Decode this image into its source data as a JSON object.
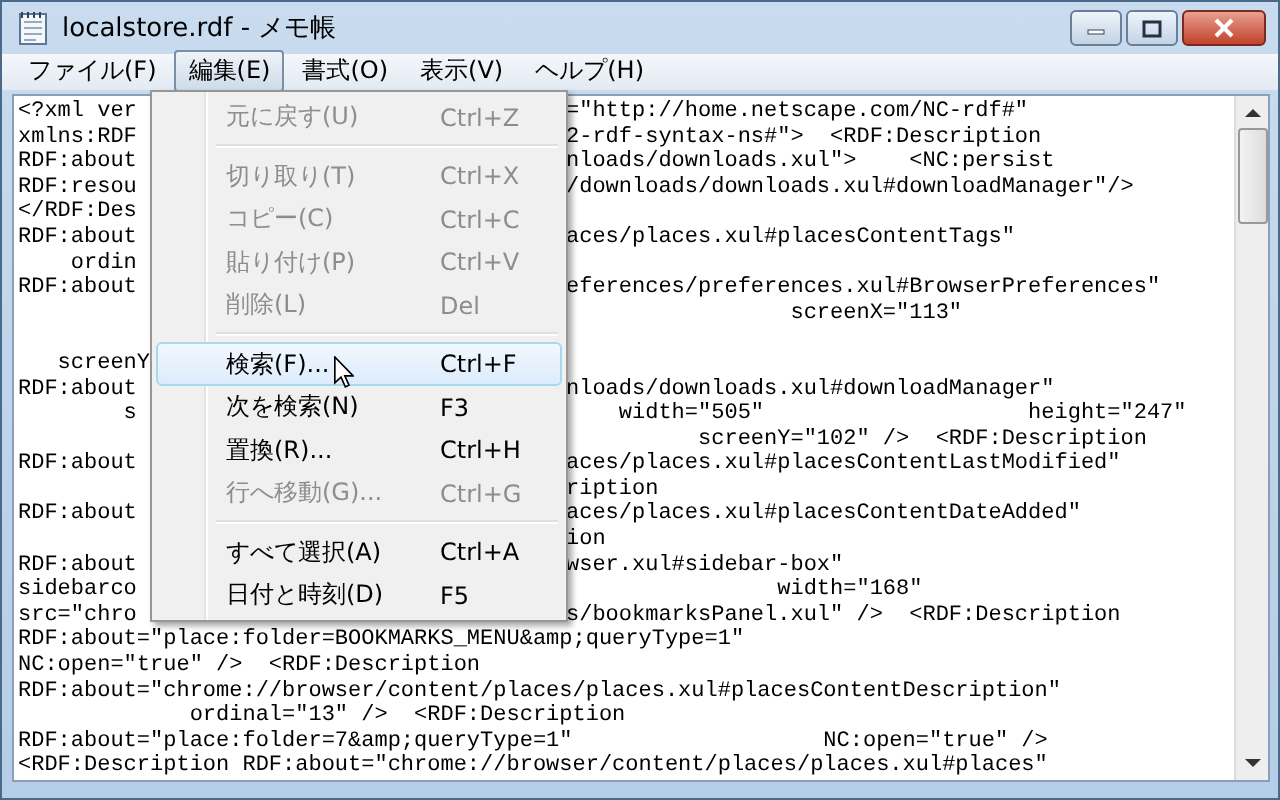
{
  "window": {
    "title": "localstore.rdf - メモ帳"
  },
  "menubar": [
    {
      "label": "ファイル(F)",
      "selected": false
    },
    {
      "label": "編集(E)",
      "selected": true
    },
    {
      "label": "書式(O)",
      "selected": false
    },
    {
      "label": "表示(V)",
      "selected": false
    },
    {
      "label": "ヘルプ(H)",
      "selected": false
    }
  ],
  "lines": [
    {
      "kind": "split",
      "left": "<?xml ver",
      "right": "=\"http://home.netscape.com/NC-rdf#\""
    },
    {
      "kind": "split",
      "left": "xmlns:RDF",
      "right": "2-rdf-syntax-ns#\">  <RDF:Description"
    },
    {
      "kind": "split",
      "left": "RDF:about",
      "right": "nloads/downloads.xul\">    <NC:persist"
    },
    {
      "kind": "split",
      "left": "RDF:resou",
      "right": "/downloads/downloads.xul#downloadManager\"/>"
    },
    {
      "kind": "split",
      "left": "</RDF:Des"
    },
    {
      "kind": "split",
      "left": "RDF:about",
      "right": "aces/places.xul#placesContentTags\""
    },
    {
      "kind": "split",
      "left": "    ordin"
    },
    {
      "kind": "split",
      "left": "RDF:about",
      "right": "eferences/preferences.xul#BrowserPreferences\""
    },
    {
      "kind": "split",
      "right": "                 screenX=\"113\""
    },
    {
      "kind": "blank"
    },
    {
      "kind": "split",
      "left": "   screenY"
    },
    {
      "kind": "split",
      "left": "RDF:about",
      "right": "nloads/downloads.xul#downloadManager\""
    },
    {
      "kind": "split",
      "left": "        s",
      "right": "    width=\"505\"                    height=\"247\""
    },
    {
      "kind": "split",
      "right": "          screenY=\"102\" />  <RDF:Description"
    },
    {
      "kind": "split",
      "left": "RDF:about",
      "right": "aces/places.xul#placesContentLastModified\""
    },
    {
      "kind": "split",
      "right": "ription"
    },
    {
      "kind": "split",
      "left": "RDF:about",
      "right": "aces/places.xul#placesContentDateAdded\""
    },
    {
      "kind": "split",
      "right": "ion"
    },
    {
      "kind": "split",
      "left": "RDF:about",
      "right": "wser.xul#sidebar-box\""
    },
    {
      "kind": "split",
      "left": "sidebarco",
      "right": "                width=\"168\""
    },
    {
      "kind": "split",
      "left": "src=\"chro",
      "right": "s/bookmarksPanel.xul\" />  <RDF:Description"
    },
    {
      "kind": "full",
      "text": "RDF:about=\"place:folder=BOOKMARKS_MENU&amp;queryType=1\""
    },
    {
      "kind": "full",
      "text": "NC:open=\"true\" />  <RDF:Description"
    },
    {
      "kind": "full",
      "text": "RDF:about=\"chrome://browser/content/places/places.xul#placesContentDescription\""
    },
    {
      "kind": "full",
      "text": "             ordinal=\"13\" />  <RDF:Description"
    },
    {
      "kind": "full",
      "text": "RDF:about=\"place:folder=7&amp;queryType=1\"                   NC:open=\"true\" />"
    },
    {
      "kind": "full",
      "text": "<RDF:Description RDF:about=\"chrome://browser/content/places/places.xul#places\""
    }
  ],
  "menu": [
    {
      "kind": "item",
      "label": "元に戻す(U)",
      "shortcut": "Ctrl+Z",
      "disabled": true,
      "selected": false
    },
    {
      "kind": "separator"
    },
    {
      "kind": "item",
      "label": "切り取り(T)",
      "shortcut": "Ctrl+X",
      "disabled": true,
      "selected": false
    },
    {
      "kind": "item",
      "label": "コピー(C)",
      "shortcut": "Ctrl+C",
      "disabled": true,
      "selected": false
    },
    {
      "kind": "item",
      "label": "貼り付け(P)",
      "shortcut": "Ctrl+V",
      "disabled": true,
      "selected": false
    },
    {
      "kind": "item",
      "label": "削除(L)",
      "shortcut": "Del",
      "disabled": true,
      "selected": false
    },
    {
      "kind": "separator"
    },
    {
      "kind": "item",
      "label": "検索(F)...",
      "shortcut": "Ctrl+F",
      "disabled": false,
      "selected": true
    },
    {
      "kind": "item",
      "label": "次を検索(N)",
      "shortcut": "F3",
      "disabled": false,
      "selected": false
    },
    {
      "kind": "item",
      "label": "置換(R)...",
      "shortcut": "Ctrl+H",
      "disabled": false,
      "selected": false
    },
    {
      "kind": "item",
      "label": "行へ移動(G)...",
      "shortcut": "Ctrl+G",
      "disabled": true,
      "selected": false
    },
    {
      "kind": "separator"
    },
    {
      "kind": "item",
      "label": "すべて選択(A)",
      "shortcut": "Ctrl+A",
      "disabled": false,
      "selected": false
    },
    {
      "kind": "item",
      "label": "日付と時刻(D)",
      "shortcut": "F5",
      "disabled": false,
      "selected": false
    }
  ]
}
